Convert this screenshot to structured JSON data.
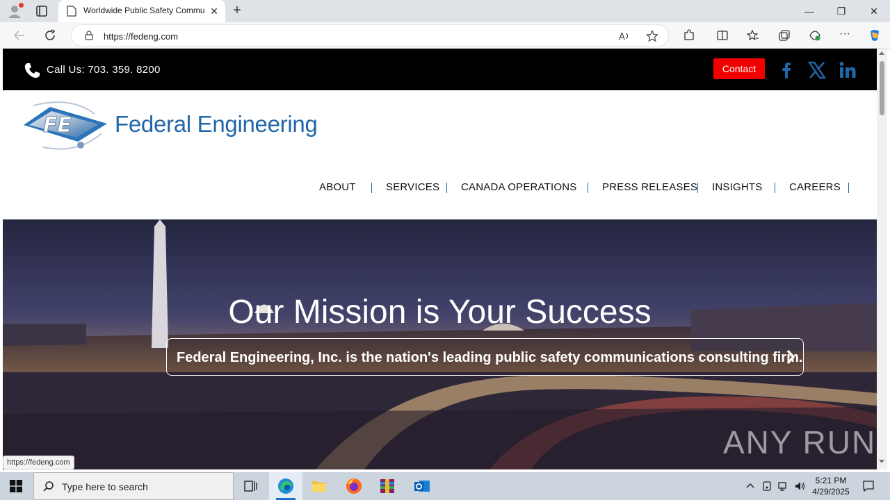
{
  "browser": {
    "tab_title": "Worldwide Public Safety Commu",
    "url": "https://fedeng.com",
    "status_url": "https://fedeng.com"
  },
  "site": {
    "call_text": "Call Us: 703. 359. 8200",
    "contact_label": "Contact",
    "social": [
      "facebook-icon",
      "x-icon",
      "linkedin-icon"
    ],
    "logo_text": "Federal Engineering",
    "logo_initials": "FE",
    "menu": [
      "ABOUT",
      "SERVICES",
      "CANADA OPERATIONS",
      "PRESS RELEASES",
      "INSIGHTS",
      "CAREERS"
    ],
    "hero_title": "Our Mission is Your Success",
    "hero_tagline": "Federal Engineering, Inc. is the nation's leading public safety communications consulting firm.",
    "watermark": "ANY RUN"
  },
  "taskbar": {
    "search_placeholder": "Type here to search",
    "time": "5:21 PM",
    "date": "4/29/2025"
  },
  "colors": {
    "brand_blue": "#2166a8",
    "contact_red": "#f20000"
  }
}
